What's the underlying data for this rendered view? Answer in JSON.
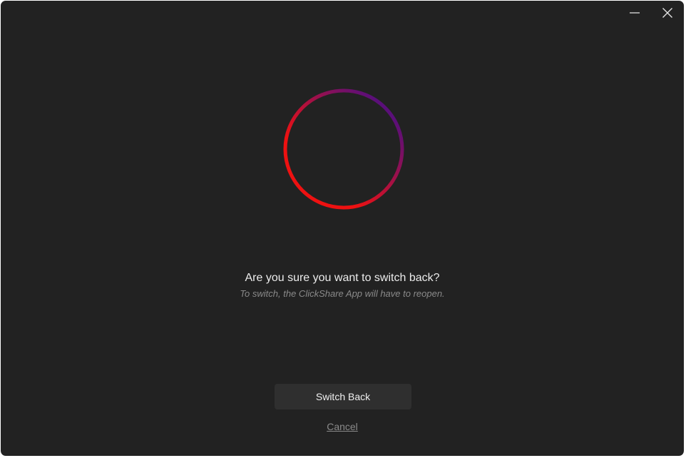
{
  "window": {
    "controls": {
      "minimize_icon": "minimize-icon",
      "close_icon": "close-icon"
    }
  },
  "ring": {
    "gradient_start": "#ee1111",
    "gradient_end": "#5a0f7a"
  },
  "dialog": {
    "question": "Are you sure you want to switch back?",
    "subtext": "To switch, the ClickShare App will have to reopen.",
    "primary_button_label": "Switch Back",
    "cancel_label": "Cancel"
  }
}
